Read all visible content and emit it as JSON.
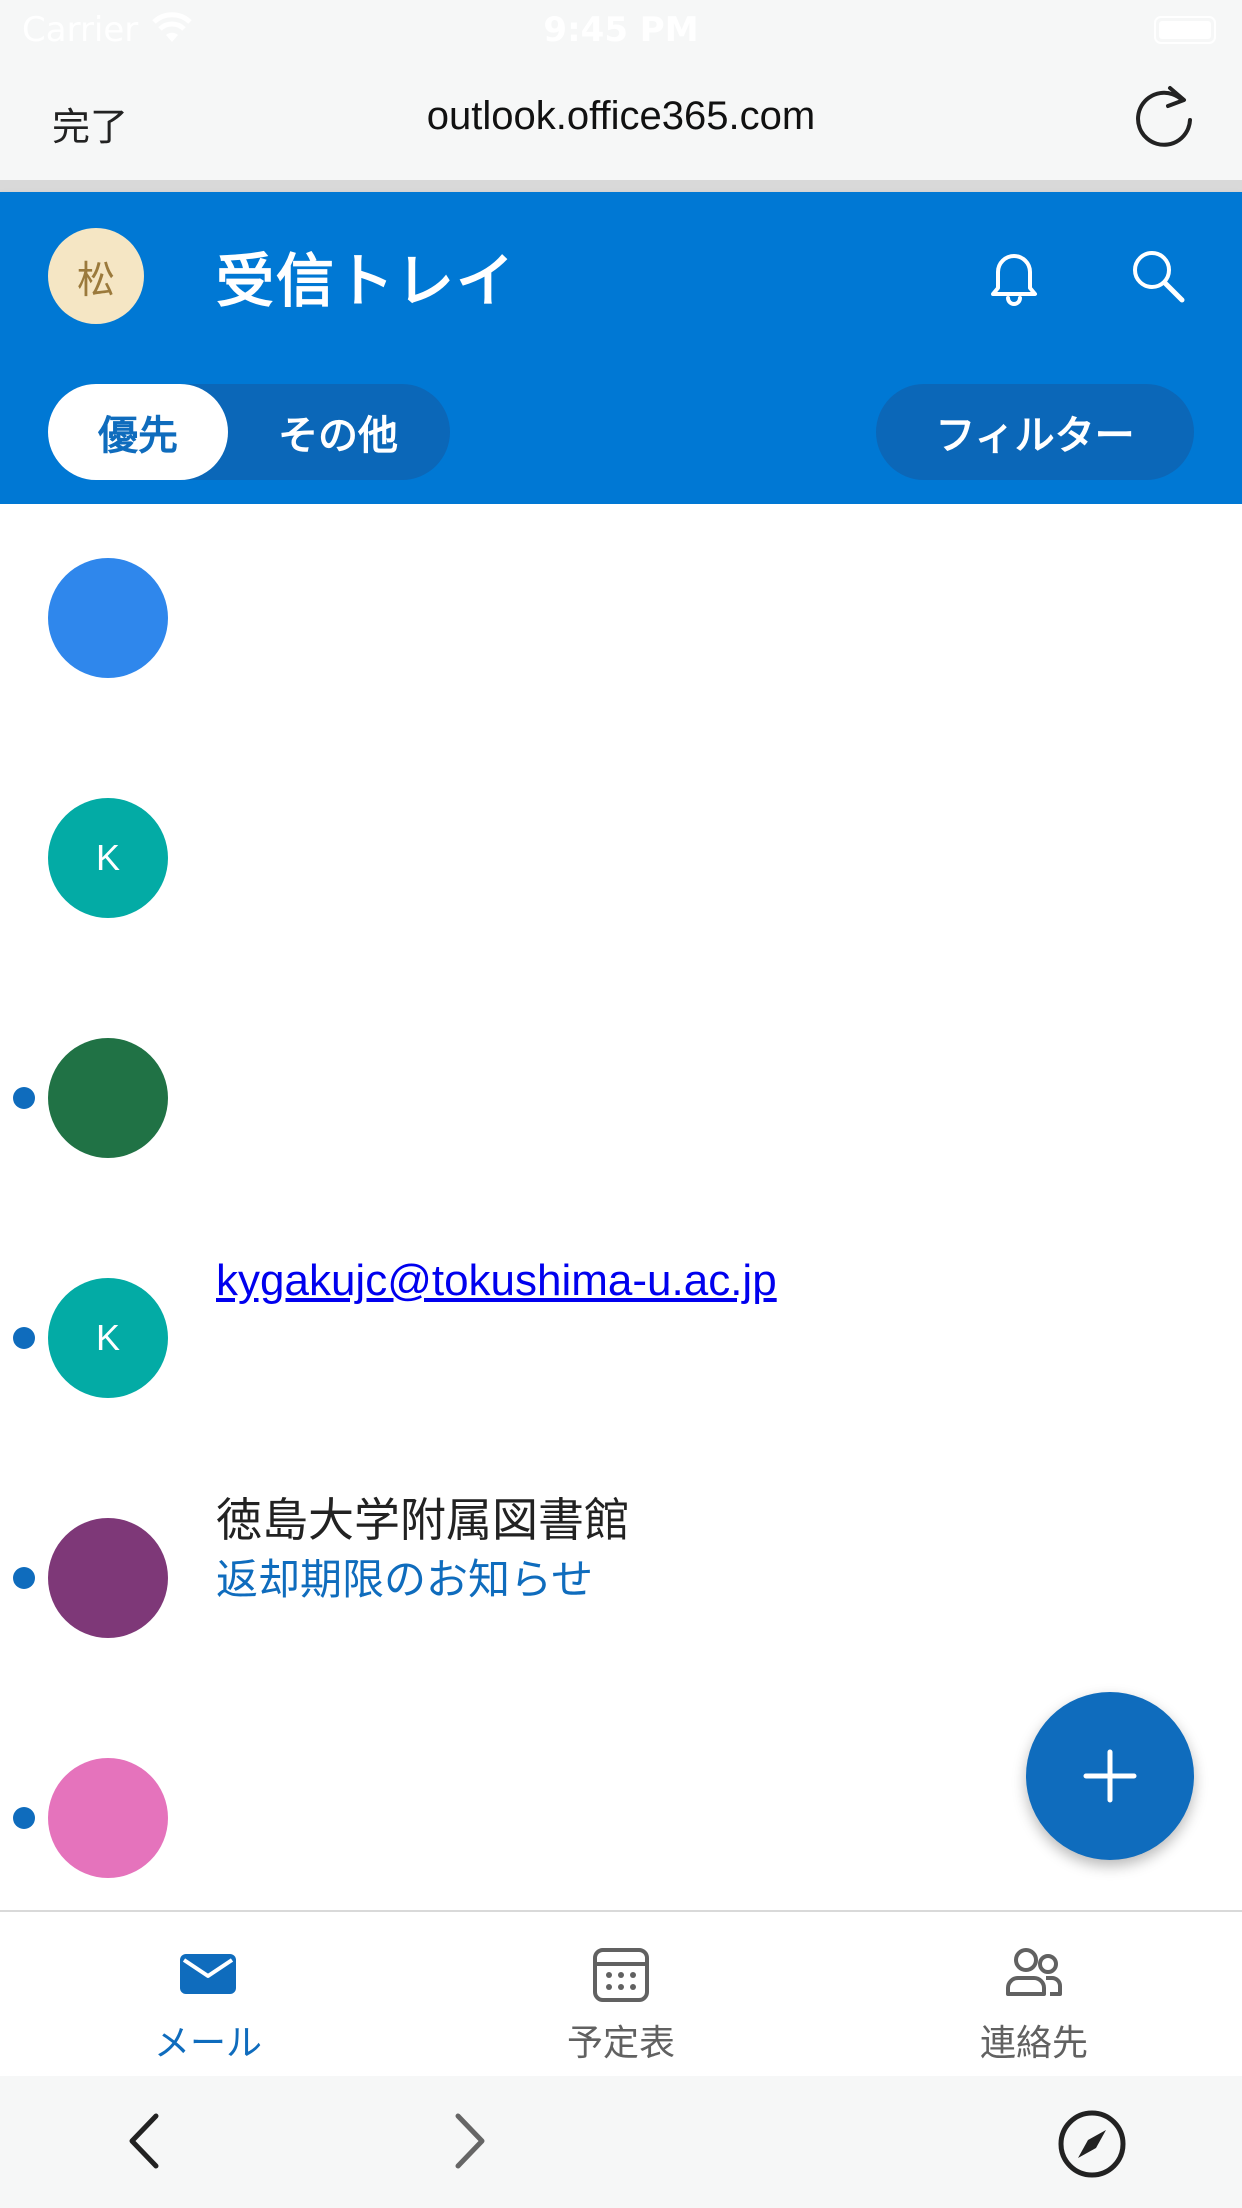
{
  "status_bar": {
    "carrier": "Carrier",
    "time": "9:45 PM"
  },
  "browser": {
    "done_label": "完了",
    "url": "outlook.office365.com"
  },
  "app_bar": {
    "account_initial": "松",
    "title": "受信トレイ",
    "segments": {
      "focused": "優先",
      "other": "その他"
    },
    "filter_label": "フィルター"
  },
  "messages": [
    {
      "avatar_letter": "",
      "avatar_color": "#2f87ec",
      "unread": false,
      "sender": "",
      "subject": ""
    },
    {
      "avatar_letter": "K",
      "avatar_color": "#03aba5",
      "unread": false,
      "sender": "",
      "subject": ""
    },
    {
      "avatar_letter": "",
      "avatar_color": "#207245",
      "unread": true,
      "sender": "",
      "subject": ""
    },
    {
      "avatar_letter": "K",
      "avatar_color": "#03aba5",
      "unread": true,
      "sender": "kygakujc@tokushima-u.ac.jp",
      "subject": ""
    },
    {
      "avatar_letter": "",
      "avatar_color": "#7e3878",
      "unread": true,
      "sender": "徳島大学附属図書館",
      "subject": "返却期限のお知らせ"
    },
    {
      "avatar_letter": "",
      "avatar_color": "#e573bc",
      "unread": true,
      "sender": "",
      "subject": ""
    }
  ],
  "tabs": [
    {
      "label": "メール",
      "icon": "mail-icon",
      "active": true
    },
    {
      "label": "予定表",
      "icon": "calendar-icon",
      "active": false
    },
    {
      "label": "連絡先",
      "icon": "people-icon",
      "active": false
    }
  ],
  "colors": {
    "brand": "#0078d4",
    "accent": "#0f6cbd",
    "unread_dot": "#0f6cbd"
  }
}
